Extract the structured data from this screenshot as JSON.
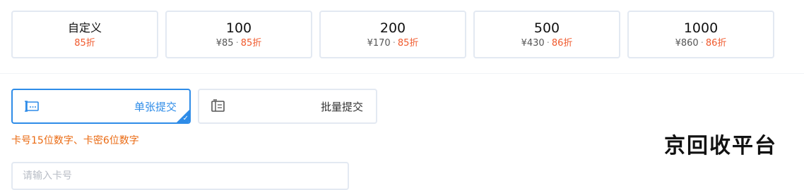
{
  "denominations": [
    {
      "amount": "自定义",
      "price": "",
      "discount": "85折"
    },
    {
      "amount": "100",
      "price": "¥85",
      "discount": "85折"
    },
    {
      "amount": "200",
      "price": "¥170",
      "discount": "85折"
    },
    {
      "amount": "500",
      "price": "¥430",
      "discount": "86折"
    },
    {
      "amount": "1000",
      "price": "¥860",
      "discount": "86折"
    }
  ],
  "separator": "·",
  "submit_modes": [
    {
      "label": "单张提交",
      "icon": "single-card-icon",
      "active": true
    },
    {
      "label": "批量提交",
      "icon": "batch-card-icon",
      "active": false
    }
  ],
  "hint": "卡号15位数字、卡密6位数字",
  "watermark": "京回收平台",
  "card_number_input": {
    "placeholder": "请输入卡号",
    "value": ""
  },
  "colors": {
    "accent": "#2e8ce8",
    "discount": "#f0592c",
    "hint": "#ea6a12",
    "border": "#e3e9f2"
  }
}
